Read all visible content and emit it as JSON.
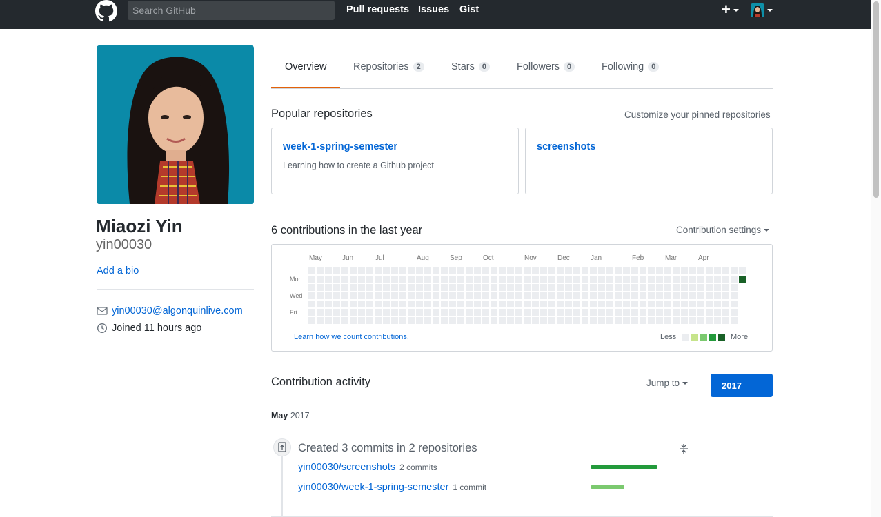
{
  "header": {
    "search_placeholder": "Search GitHub",
    "nav": [
      "Pull requests",
      "Issues",
      "Gist"
    ],
    "plus_label": "+"
  },
  "profile": {
    "name": "Miaozi Yin",
    "login": "yin00030",
    "add_bio": "Add a bio",
    "email": "yin00030@algonquinlive.com",
    "joined": "Joined 11 hours ago"
  },
  "tabs": [
    {
      "label": "Overview",
      "count": ""
    },
    {
      "label": "Repositories",
      "count": "2"
    },
    {
      "label": "Stars",
      "count": "0"
    },
    {
      "label": "Followers",
      "count": "0"
    },
    {
      "label": "Following",
      "count": "0"
    }
  ],
  "popular": {
    "title": "Popular repositories",
    "customize": "Customize your pinned repositories",
    "repos": [
      {
        "name": "week-1-spring-semester",
        "description": "Learning how to create a Github project"
      },
      {
        "name": "screenshots",
        "description": ""
      }
    ]
  },
  "contributions": {
    "title": "6 contributions in the last year",
    "settings": "Contribution settings",
    "months": [
      "May",
      "Jun",
      "Jul",
      "Aug",
      "Sep",
      "Oct",
      "Nov",
      "Dec",
      "Jan",
      "Feb",
      "Mar",
      "Apr"
    ],
    "days": [
      "Mon",
      "Wed",
      "Fri"
    ],
    "learn": "Learn how we count contributions.",
    "less": "Less",
    "more": "More",
    "colors": [
      "#ebedf0",
      "#c6e48b",
      "#7bc96f",
      "#239a3b",
      "#196127"
    ]
  },
  "activity": {
    "title": "Contribution activity",
    "jump_to": "Jump to",
    "year": "2017",
    "month_bold": "May",
    "month_year": "2017",
    "created": "Created 3 commits in 2 repositories",
    "rows": [
      {
        "repo": "yin00030/screenshots",
        "commits": "2 commits",
        "fraction": 1.0,
        "color": "#239a3b"
      },
      {
        "repo": "yin00030/week-1-spring-semester",
        "commits": "1 commit",
        "fraction": 0.5,
        "color": "#7bc96f"
      }
    ]
  }
}
